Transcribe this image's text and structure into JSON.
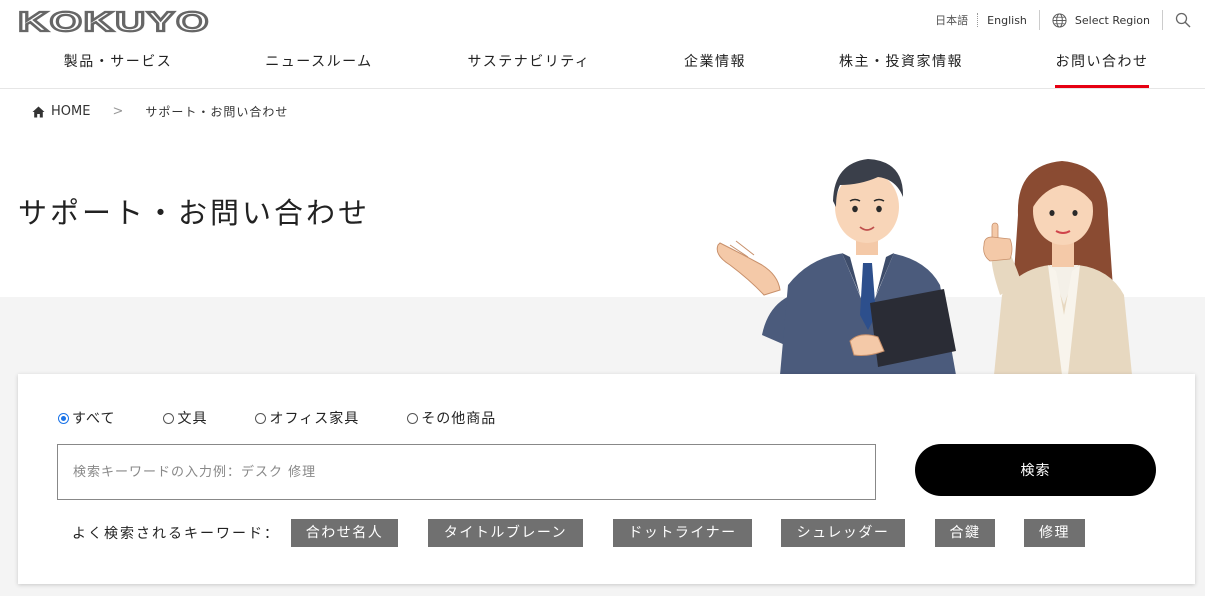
{
  "header": {
    "logo_text": "KOKUYO",
    "lang_ja": "日本語",
    "lang_en": "English",
    "region_label": "Select Region"
  },
  "nav": {
    "items": [
      {
        "label": "製品・サービス"
      },
      {
        "label": "ニュースルーム"
      },
      {
        "label": "サステナビリティ"
      },
      {
        "label": "企業情報"
      },
      {
        "label": "株主・投資家情報"
      },
      {
        "label": "お問い合わせ",
        "active": true
      }
    ]
  },
  "breadcrumb": {
    "home": "HOME",
    "separator": ">",
    "current": "サポート・お問い合わせ"
  },
  "page": {
    "title": "サポート・お問い合わせ"
  },
  "search": {
    "categories": [
      {
        "label": "すべて",
        "checked": true
      },
      {
        "label": "文具",
        "checked": false
      },
      {
        "label": "オフィス家具",
        "checked": false
      },
      {
        "label": "その他商品",
        "checked": false
      }
    ],
    "placeholder": "検索キーワードの入力例：デスク 修理",
    "button_label": "検索",
    "keywords_label": "よく検索されるキーワード：",
    "keywords": [
      "合わせ名人",
      "タイトルブレーン",
      "ドットライナー",
      "シュレッダー",
      "合鍵",
      "修理"
    ]
  },
  "colors": {
    "accent": "#e60012",
    "button_bg": "#000000",
    "keyword_bg": "#707070",
    "band_bg": "#f4f4f4",
    "radio_checked": "#1a73e8"
  }
}
